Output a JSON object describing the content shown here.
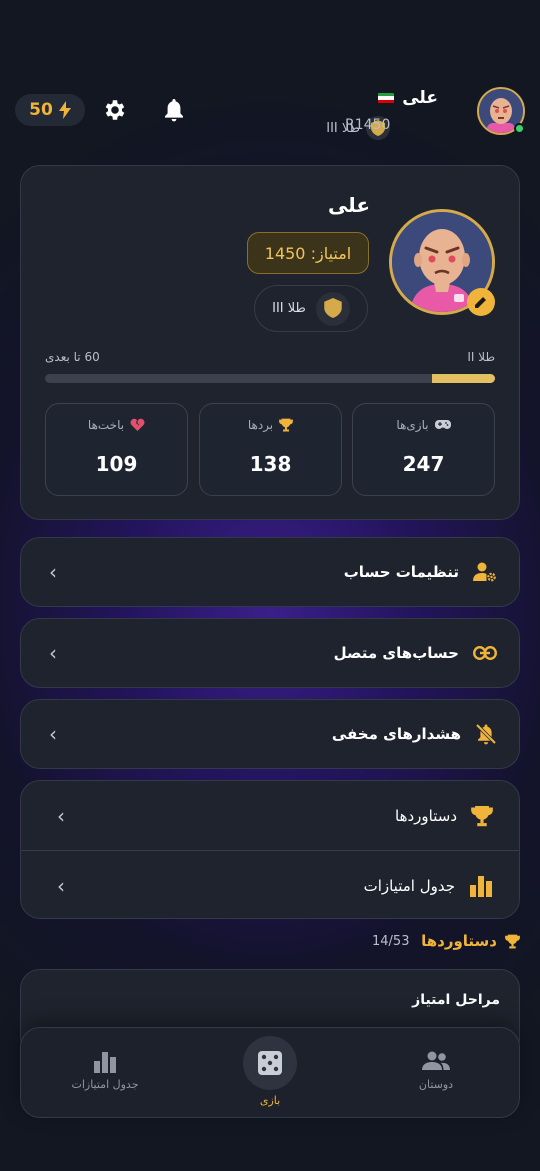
{
  "header": {
    "energy": "50",
    "username": "علی",
    "flag_icon": "iran-flag-icon",
    "rank": "طلا III",
    "rating": "R1450"
  },
  "profile": {
    "name": "علی",
    "score": "امتیاز: 1450",
    "rank": "طلا III",
    "progress_left": "60 تا بعدی",
    "progress_right": "طلا II",
    "progress_fraction": 0.14,
    "stats": [
      {
        "label": "بازی‌ها",
        "value": "247",
        "icon": "gamepad-icon"
      },
      {
        "label": "بردها",
        "value": "138",
        "icon": "trophy-icon"
      },
      {
        "label": "باخت‌ها",
        "value": "109",
        "icon": "broken-heart-icon"
      }
    ]
  },
  "menu": {
    "account_settings": "تنظیمات حساب",
    "connected_accounts": "حساب‌های متصل",
    "hidden_alerts": "هشدارهای مخفی",
    "achievements": "دستاوردها",
    "leaderboard": "جدول امتیازات"
  },
  "achievements": {
    "title": "دستاوردها",
    "count": "14/53",
    "stages_title": "مراحل امتیاز"
  },
  "nav": {
    "friends": "دوستان",
    "play": "بازی",
    "leaderboard": "جدول امتیازات"
  },
  "colors": {
    "accent": "#f0b43a",
    "gold_border": "#d4aa4a",
    "card": "#1e232d",
    "online": "#3ccf6b"
  }
}
